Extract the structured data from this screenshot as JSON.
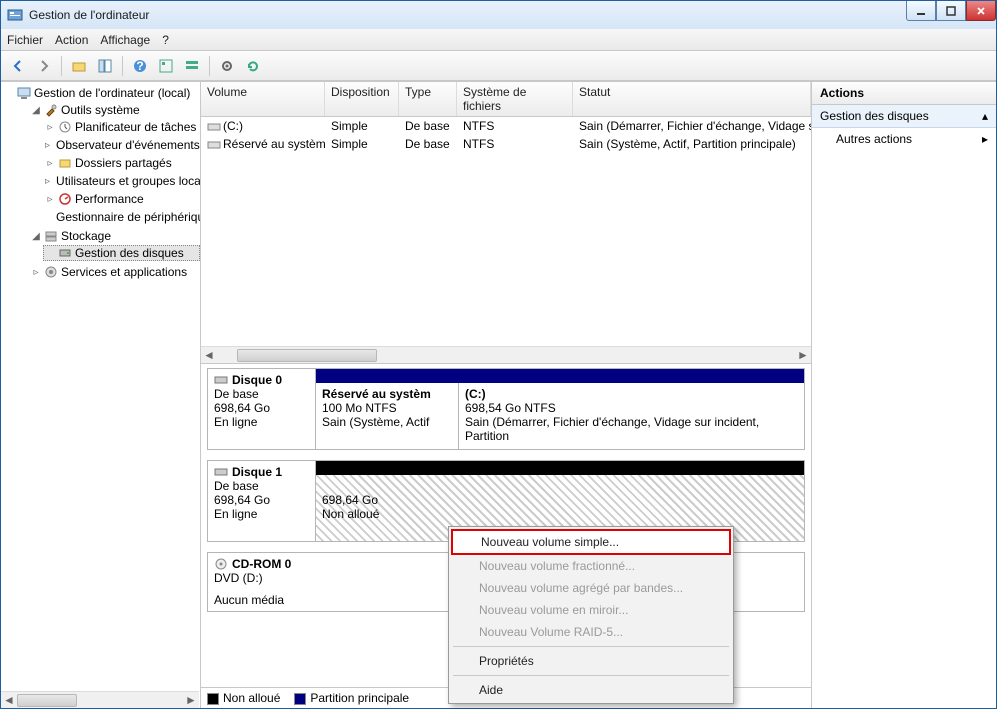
{
  "window": {
    "title": "Gestion de l'ordinateur"
  },
  "menu": {
    "file": "Fichier",
    "action": "Action",
    "view": "Affichage",
    "help": "?"
  },
  "tree": {
    "root": "Gestion de l'ordinateur (local)",
    "system_tools": "Outils système",
    "task_scheduler": "Planificateur de tâches",
    "event_viewer": "Observateur d'événements",
    "shared_folders": "Dossiers partagés",
    "users_groups": "Utilisateurs et groupes locaux",
    "performance": "Performance",
    "device_manager": "Gestionnaire de périphériques",
    "storage": "Stockage",
    "disk_mgmt": "Gestion des disques",
    "services_apps": "Services et applications"
  },
  "list": {
    "headers": {
      "volume": "Volume",
      "layout": "Disposition",
      "type": "Type",
      "fs": "Système de fichiers",
      "status": "Statut"
    },
    "rows": [
      {
        "volume": "(C:)",
        "layout": "Simple",
        "type": "De base",
        "fs": "NTFS",
        "status": "Sain (Démarrer, Fichier d'échange, Vidage sur incident)"
      },
      {
        "volume": "Réservé au système",
        "layout": "Simple",
        "type": "De base",
        "fs": "NTFS",
        "status": "Sain (Système, Actif, Partition principale)"
      }
    ]
  },
  "disks": {
    "d0": {
      "name": "Disque 0",
      "type": "De base",
      "size": "698,64 Go",
      "state": "En ligne",
      "p0": {
        "name": "Réservé au systèm",
        "line2": "100 Mo NTFS",
        "line3": "Sain (Système, Actif"
      },
      "p1": {
        "name": "(C:)",
        "line2": "698,54 Go NTFS",
        "line3": "Sain (Démarrer, Fichier d'échange, Vidage sur incident, Partition"
      }
    },
    "d1": {
      "name": "Disque 1",
      "type": "De base",
      "size": "698,64 Go",
      "state": "En ligne",
      "p0": {
        "line2": "698,64 Go",
        "line3": "Non alloué"
      }
    },
    "d2": {
      "name": "CD-ROM 0",
      "type": "DVD (D:)",
      "state": "Aucun média"
    }
  },
  "legend": {
    "unalloc": "Non alloué",
    "primary": "Partition principale"
  },
  "actions": {
    "header": "Actions",
    "group": "Gestion des disques",
    "more": "Autres actions"
  },
  "context": {
    "simple": "Nouveau volume simple...",
    "spanned": "Nouveau volume fractionné...",
    "striped": "Nouveau volume agrégé par bandes...",
    "mirror": "Nouveau volume en miroir...",
    "raid5": "Nouveau Volume RAID-5...",
    "properties": "Propriétés",
    "help": "Aide"
  }
}
